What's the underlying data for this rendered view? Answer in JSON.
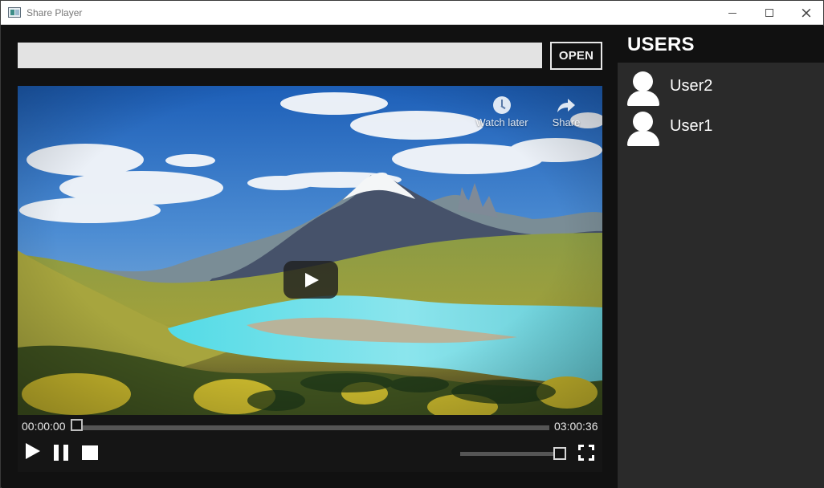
{
  "window": {
    "title": "Share Player",
    "icon_name": "app-window-icon",
    "controls": {
      "minimize_icon": "minimize-icon",
      "maximize_icon": "maximize-icon",
      "close_icon": "close-icon"
    }
  },
  "toolbar": {
    "url_value": "",
    "url_placeholder": "",
    "open_label": "OPEN"
  },
  "video": {
    "overlay": {
      "watch_later_label": "Watch later",
      "share_label": "Share",
      "play_icon": "play-icon",
      "watch_later_icon": "clock-icon",
      "share_icon": "share-icon"
    },
    "scene": "landscape-thumbnail"
  },
  "player": {
    "current_time": "00:00:00",
    "total_time": "03:00:36",
    "progress_fraction": 0,
    "volume_fraction": 1,
    "controls": {
      "play_icon": "play-icon",
      "pause_icon": "pause-icon",
      "stop_icon": "stop-icon",
      "fullscreen_icon": "fullscreen-icon"
    }
  },
  "users": {
    "title": "USERS",
    "items": [
      {
        "name": "User2",
        "icon": "user-avatar-icon"
      },
      {
        "name": "User1",
        "icon": "user-avatar-icon"
      }
    ]
  },
  "colors": {
    "main_background": "#111111",
    "sidebar_background": "#2a2a2a",
    "input_background": "#e3e3e3",
    "text_primary": "#ffffff",
    "control_track": "#555555"
  }
}
